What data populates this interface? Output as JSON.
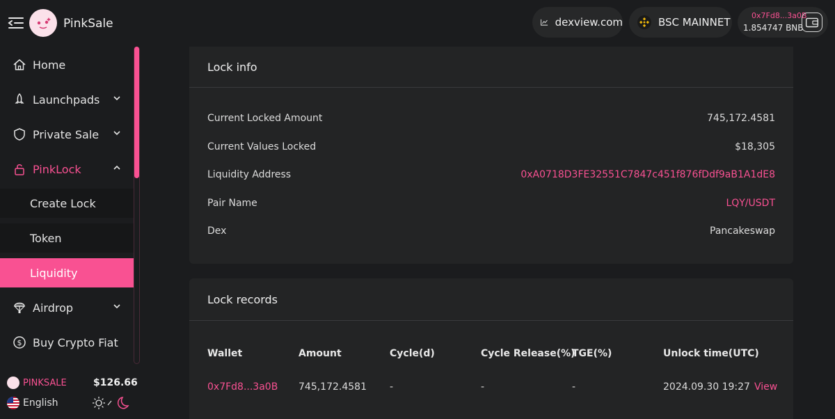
{
  "brand": {
    "name": "PinkSale"
  },
  "header": {
    "dex_label": "dexview.com",
    "network_label": "BSC MAINNET",
    "wallet_address": "0x7Fd8...3a0B",
    "wallet_balance": "1.854747 BNB"
  },
  "sidebar": {
    "items": [
      {
        "label": "Home",
        "icon": "home-icon"
      },
      {
        "label": "Launchpads",
        "icon": "rocket-icon"
      },
      {
        "label": "Private Sale",
        "icon": "shield-icon"
      },
      {
        "label": "PinkLock",
        "icon": "lock-icon"
      },
      {
        "label": "Airdrop",
        "icon": "parachute-icon"
      },
      {
        "label": "Buy Crypto Fiat",
        "icon": "dollar-icon"
      }
    ],
    "subitems": [
      {
        "label": "Create Lock"
      },
      {
        "label": "Token"
      },
      {
        "label": "Liquidity"
      }
    ],
    "footer": {
      "token_name": "PINKSALE",
      "token_price": "$126.66",
      "language": "English"
    }
  },
  "lock_info": {
    "title": "Lock info",
    "rows": [
      {
        "label": "Current Locked Amount",
        "value": "745,172.4581"
      },
      {
        "label": "Current Values Locked",
        "value": "$18,305"
      },
      {
        "label": "Liquidity Address",
        "value": "0xA0718D3FE32551C7847c451f876fDdf9aB1A1dE8"
      },
      {
        "label": "Pair Name",
        "value": "LQY/USDT"
      },
      {
        "label": "Dex",
        "value": "Pancakeswap"
      }
    ]
  },
  "lock_records": {
    "title": "Lock records",
    "columns": [
      "Wallet",
      "Amount",
      "Cycle(d)",
      "Cycle Release(%)",
      "TGE(%)",
      "Unlock time(UTC)"
    ],
    "rows": [
      {
        "wallet": "0x7Fd8...3a0B",
        "amount": "745,172.4581",
        "cycle": "-",
        "cycle_release": "-",
        "tge": "-",
        "unlock_time": "2024.09.30 19:27",
        "action": "View"
      }
    ]
  },
  "colors": {
    "accent": "#f95192",
    "background": "#1b1c1e",
    "card": "#232425"
  }
}
